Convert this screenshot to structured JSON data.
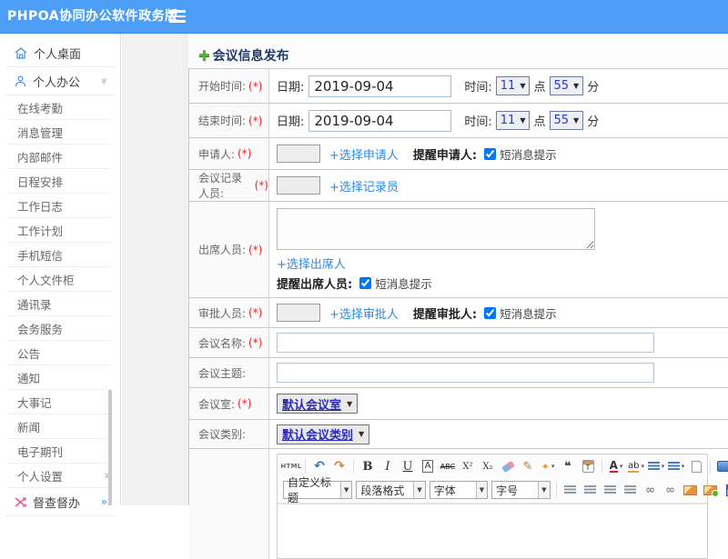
{
  "header": {
    "brand": "PHPOA协同办公软件政务版"
  },
  "sidebar": {
    "desktop": "个人桌面",
    "office": "个人办公",
    "office_items": [
      "在线考勤",
      "消息管理",
      "内部邮件",
      "日程安排",
      "工作日志",
      "工作计划",
      "手机短信",
      "个人文件柜",
      "通讯录",
      "会务服务",
      "公告",
      "通知",
      "大事记",
      "新闻",
      "电子期刊",
      "个人设置"
    ],
    "inspect": "督查督办"
  },
  "form": {
    "title": "会议信息发布",
    "rows": {
      "start_time": {
        "label": "开始时间:",
        "req": "(*)",
        "date_label": "日期:",
        "date_value": "2019-09-04",
        "time_label": "时间:",
        "hour": "11",
        "hour_unit": "点",
        "minute": "55",
        "minute_unit": "分"
      },
      "end_time": {
        "label": "结束时间:",
        "req": "(*)",
        "date_label": "日期:",
        "date_value": "2019-09-04",
        "time_label": "时间:",
        "hour": "11",
        "hour_unit": "点",
        "minute": "55",
        "minute_unit": "分"
      },
      "applicant": {
        "label": "申请人:",
        "req": "(*)",
        "link": "+选择申请人",
        "remind": "提醒申请人:",
        "sms": "短消息提示",
        "sms_checked": true
      },
      "recorder": {
        "label": "会议记录人员:",
        "req": "(*)",
        "link": "+选择记录员"
      },
      "attendees": {
        "label": "出席人员:",
        "req": "(*)",
        "link": "+选择出席人",
        "remind": "提醒出席人员:",
        "sms": "短消息提示",
        "sms_checked": true
      },
      "approver": {
        "label": "审批人员:",
        "req": "(*)",
        "link": "+选择审批人",
        "remind": "提醒审批人:",
        "sms": "短消息提示",
        "sms_checked": true
      },
      "name": {
        "label": "会议名称:",
        "req": "(*)",
        "value": ""
      },
      "subject": {
        "label": "会议主题:",
        "value": ""
      },
      "room": {
        "label": "会议室:",
        "req": "(*)",
        "value": "默认会议室"
      },
      "category": {
        "label": "会议类别:",
        "value": "默认会议类别"
      }
    }
  },
  "editor": {
    "selects": {
      "heading": "自定义标题",
      "paragraph": "段落格式",
      "font": "字体",
      "size": "字号"
    }
  },
  "icons": {
    "html": "HTML",
    "undo": "↶",
    "redo": "↷",
    "bold": "B",
    "italic": "I",
    "underline": "U",
    "font_box": "A",
    "strikethrough": "ABC",
    "superscript": "X²",
    "subscript": "X₂",
    "wand": "✦",
    "quote": "❝",
    "paste_text": "T",
    "font_color": "A",
    "highlight": "ab",
    "dropdown": "▾",
    "select_arrow": "▼",
    "link": "∞",
    "unlink": "∞",
    "table_grid": "▦",
    "plus": "✚",
    "chevron_double": "»"
  },
  "colors": {
    "header_blue": "#4d9ef6",
    "link_blue": "#2c8ae8",
    "required_red": "#ee2222",
    "sidebar_icon_blue": "#4a90d9",
    "inspect_pink": "#e85d8a",
    "select_text_blue": "#2a2ab8",
    "plus_green": "#4db52e"
  }
}
